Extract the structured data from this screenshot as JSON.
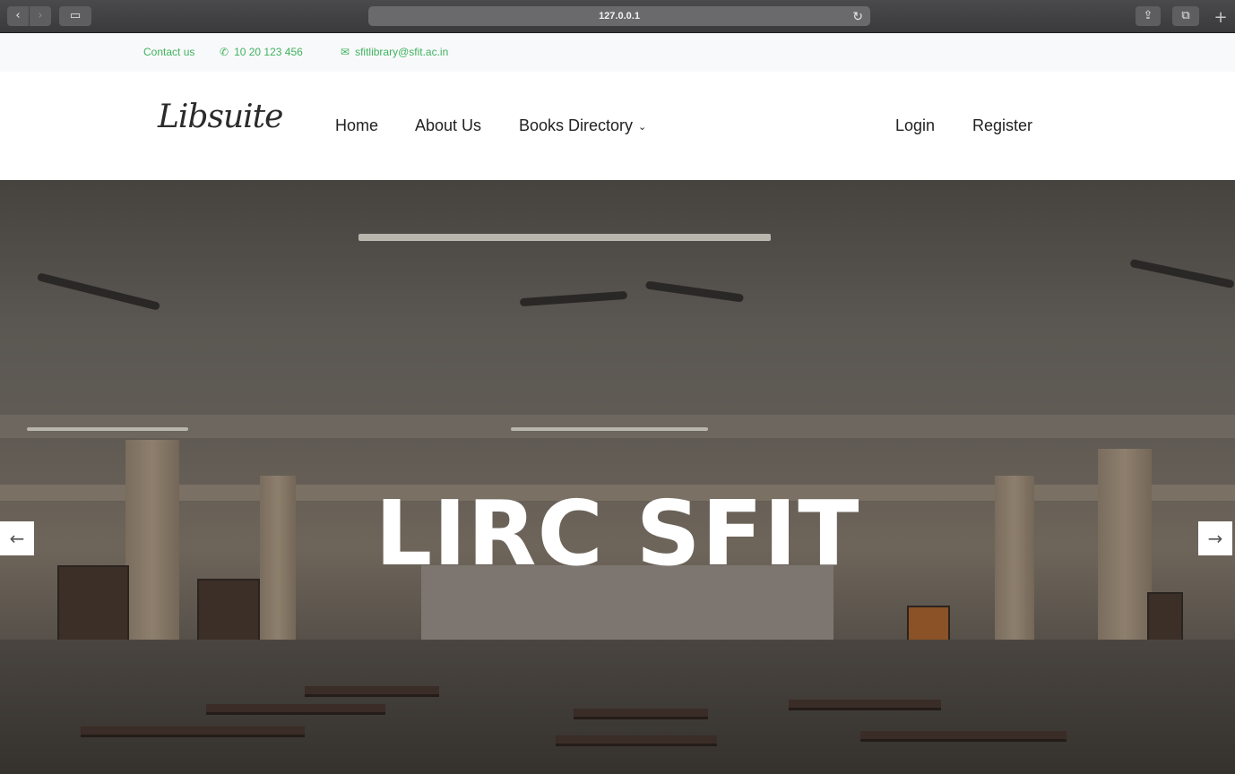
{
  "browser": {
    "url": "127.0.0.1",
    "back_icon": "‹",
    "forward_icon": "›",
    "sidebar_icon": "▭",
    "reload_icon": "↻",
    "share_icon": "⇪",
    "tabs_icon": "⧉",
    "newtab_icon": "+"
  },
  "topbar": {
    "contact_label": "Contact us",
    "phone_icon": "✆",
    "phone": "10 20 123 456",
    "email_icon": "✉",
    "email": "sfitlibrary@sfit.ac.in",
    "accent_color": "#3fb35f"
  },
  "navbar": {
    "logo": "Libsuite",
    "links": [
      {
        "label": "Home"
      },
      {
        "label": "About Us"
      },
      {
        "label": "Books Directory"
      }
    ],
    "dropdown_icon": "⌄",
    "login": "Login",
    "register": "Register"
  },
  "hero": {
    "title": "LIRC SFIT",
    "prev_icon": "←",
    "next_icon": "→"
  }
}
